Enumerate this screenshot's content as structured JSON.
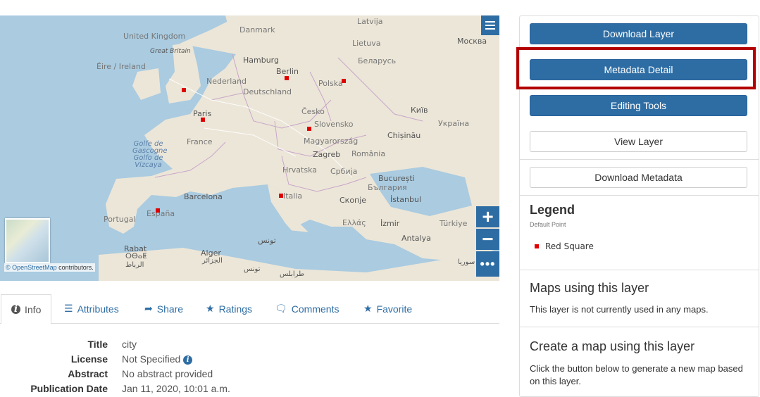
{
  "map": {
    "labels": {
      "united_kingdom": "United Kingdom",
      "great_britain": "Great Britain",
      "eire": "Éire / Ireland",
      "danmark": "Danmark",
      "latvija": "Latvija",
      "lietuva": "Lietuva",
      "moskva": "Москва",
      "hamburg": "Hamburg",
      "berlin": "Berlin",
      "nederland": "Nederland",
      "belarus": "Беларусь",
      "polska": "Polska",
      "deutschland": "Deutschland",
      "paris": "Paris",
      "cesko": "Česko",
      "kyiv": "Київ",
      "slovensko": "Slovensko",
      "ukraina": "Україна",
      "france": "France",
      "magyarorszag": "Magyarország",
      "chisinau": "Chișinău",
      "golfe": "Golfe de Gascogne Golfo de Vizcaya",
      "zagreb": "Zagreb",
      "romania": "România",
      "hrvatska": "Hrvatska",
      "srbija": "Србија",
      "bucuresti": "București",
      "balgariya": "България",
      "barcelona": "Barcelona",
      "italia": "Italia",
      "skopje": "Скопје",
      "istanbul": "İstanbul",
      "espana": "España",
      "portugal": "Portugal",
      "ellada": "Ελλάς",
      "izmir": "İzmir",
      "turkiye": "Türkiye",
      "antalya": "Antalya",
      "tunis": "تونس",
      "rabat": "Rabat",
      "rabat_tif": "ⵔⴱⴰⵟ",
      "rabat_ar": "الرباط",
      "alger": "Alger",
      "alger_ar": "الجزائر",
      "tunisia": "تونس",
      "tarabulus": "طرابلس",
      "syria": "سوريا"
    },
    "attribution_link": "© OpenStreetMap",
    "attribution_text": " contributors."
  },
  "tabs": [
    {
      "label": "Info",
      "icon": "info-icon"
    },
    {
      "label": "Attributes",
      "icon": "list-icon"
    },
    {
      "label": "Share",
      "icon": "share-icon"
    },
    {
      "label": "Ratings",
      "icon": "star-icon"
    },
    {
      "label": "Comments",
      "icon": "comment-icon"
    },
    {
      "label": "Favorite",
      "icon": "star-icon"
    }
  ],
  "info": {
    "title_label": "Title",
    "title_value": "city",
    "license_label": "License",
    "license_value": "Not Specified",
    "abstract_label": "Abstract",
    "abstract_value": "No abstract provided",
    "pubdate_label": "Publication Date",
    "pubdate_value": "Jan 11, 2020, 10:01 a.m."
  },
  "panel": {
    "download_layer": "Download Layer",
    "metadata_detail": "Metadata Detail",
    "editing_tools": "Editing Tools",
    "view_layer": "View Layer",
    "download_metadata": "Download Metadata",
    "legend_title": "Legend",
    "legend_style": "Default Point",
    "legend_item": "Red Square",
    "maps_title": "Maps using this layer",
    "maps_text": "This layer is not currently used in any maps.",
    "create_title": "Create a map using this layer",
    "create_text": "Click the button below to generate a new map based on this layer."
  },
  "colors": {
    "primary": "#2e6da4",
    "highlight": "#b30000",
    "marker": "#e00000"
  }
}
